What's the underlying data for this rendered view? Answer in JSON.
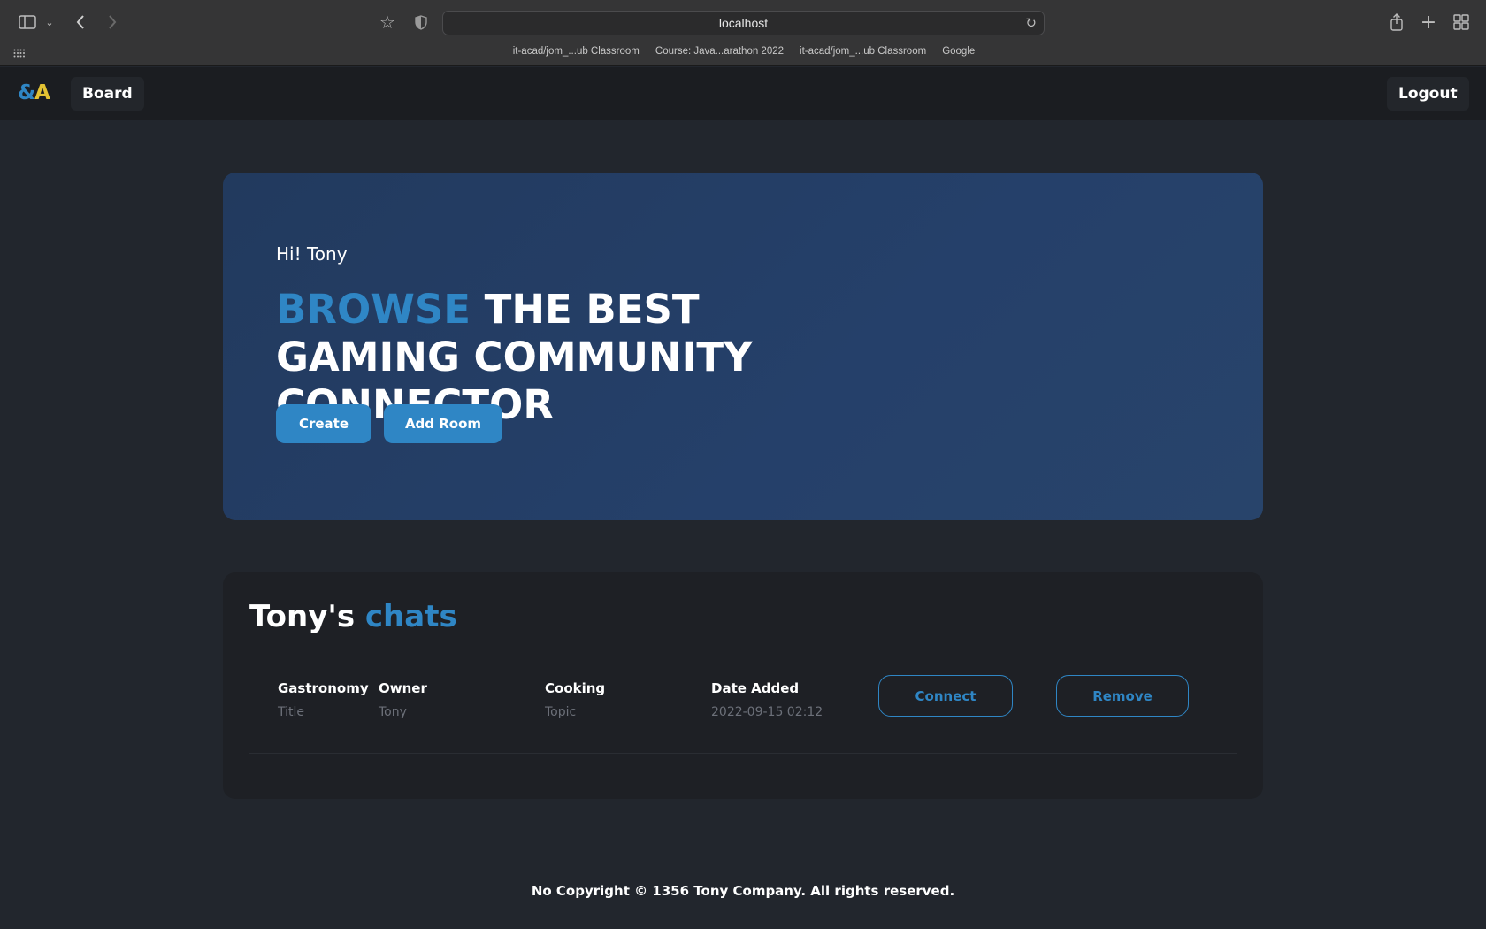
{
  "browser": {
    "url": "localhost",
    "bookmarks": [
      "it-acad/jom_...ub Classroom",
      "Course: Java...arathon 2022",
      "it-acad/jom_...ub Classroom",
      "Google"
    ]
  },
  "header": {
    "logo_amp": "&",
    "logo_a": "A",
    "board_label": "Board",
    "logout_label": "Logout"
  },
  "hero": {
    "greeting": "Hi! Tony",
    "title_accent": "BROWSE",
    "title_rest": " THE BEST GAMING COMMUNITY CONNECTOR",
    "create_label": "Create",
    "add_room_label": "Add Room"
  },
  "chats": {
    "title_owner": "Tony's",
    "title_accent": "chats",
    "rows": [
      {
        "title_value": "Gastronomy",
        "title_label": "Title",
        "owner_label": "Owner",
        "owner_value": "Tony",
        "topic_value": "Cooking",
        "topic_label": "Topic",
        "date_label": "Date Added",
        "date_value": "2022-09-15 02:12",
        "connect_label": "Connect",
        "remove_label": "Remove"
      }
    ]
  },
  "footer": {
    "text": "No Copyright © 1356 Tony Company. All rights reserved."
  },
  "colors": {
    "accent": "#2f86c5",
    "logo_yellow": "#e3c233",
    "background": "#22262d",
    "hero_bg": "#24406a"
  }
}
